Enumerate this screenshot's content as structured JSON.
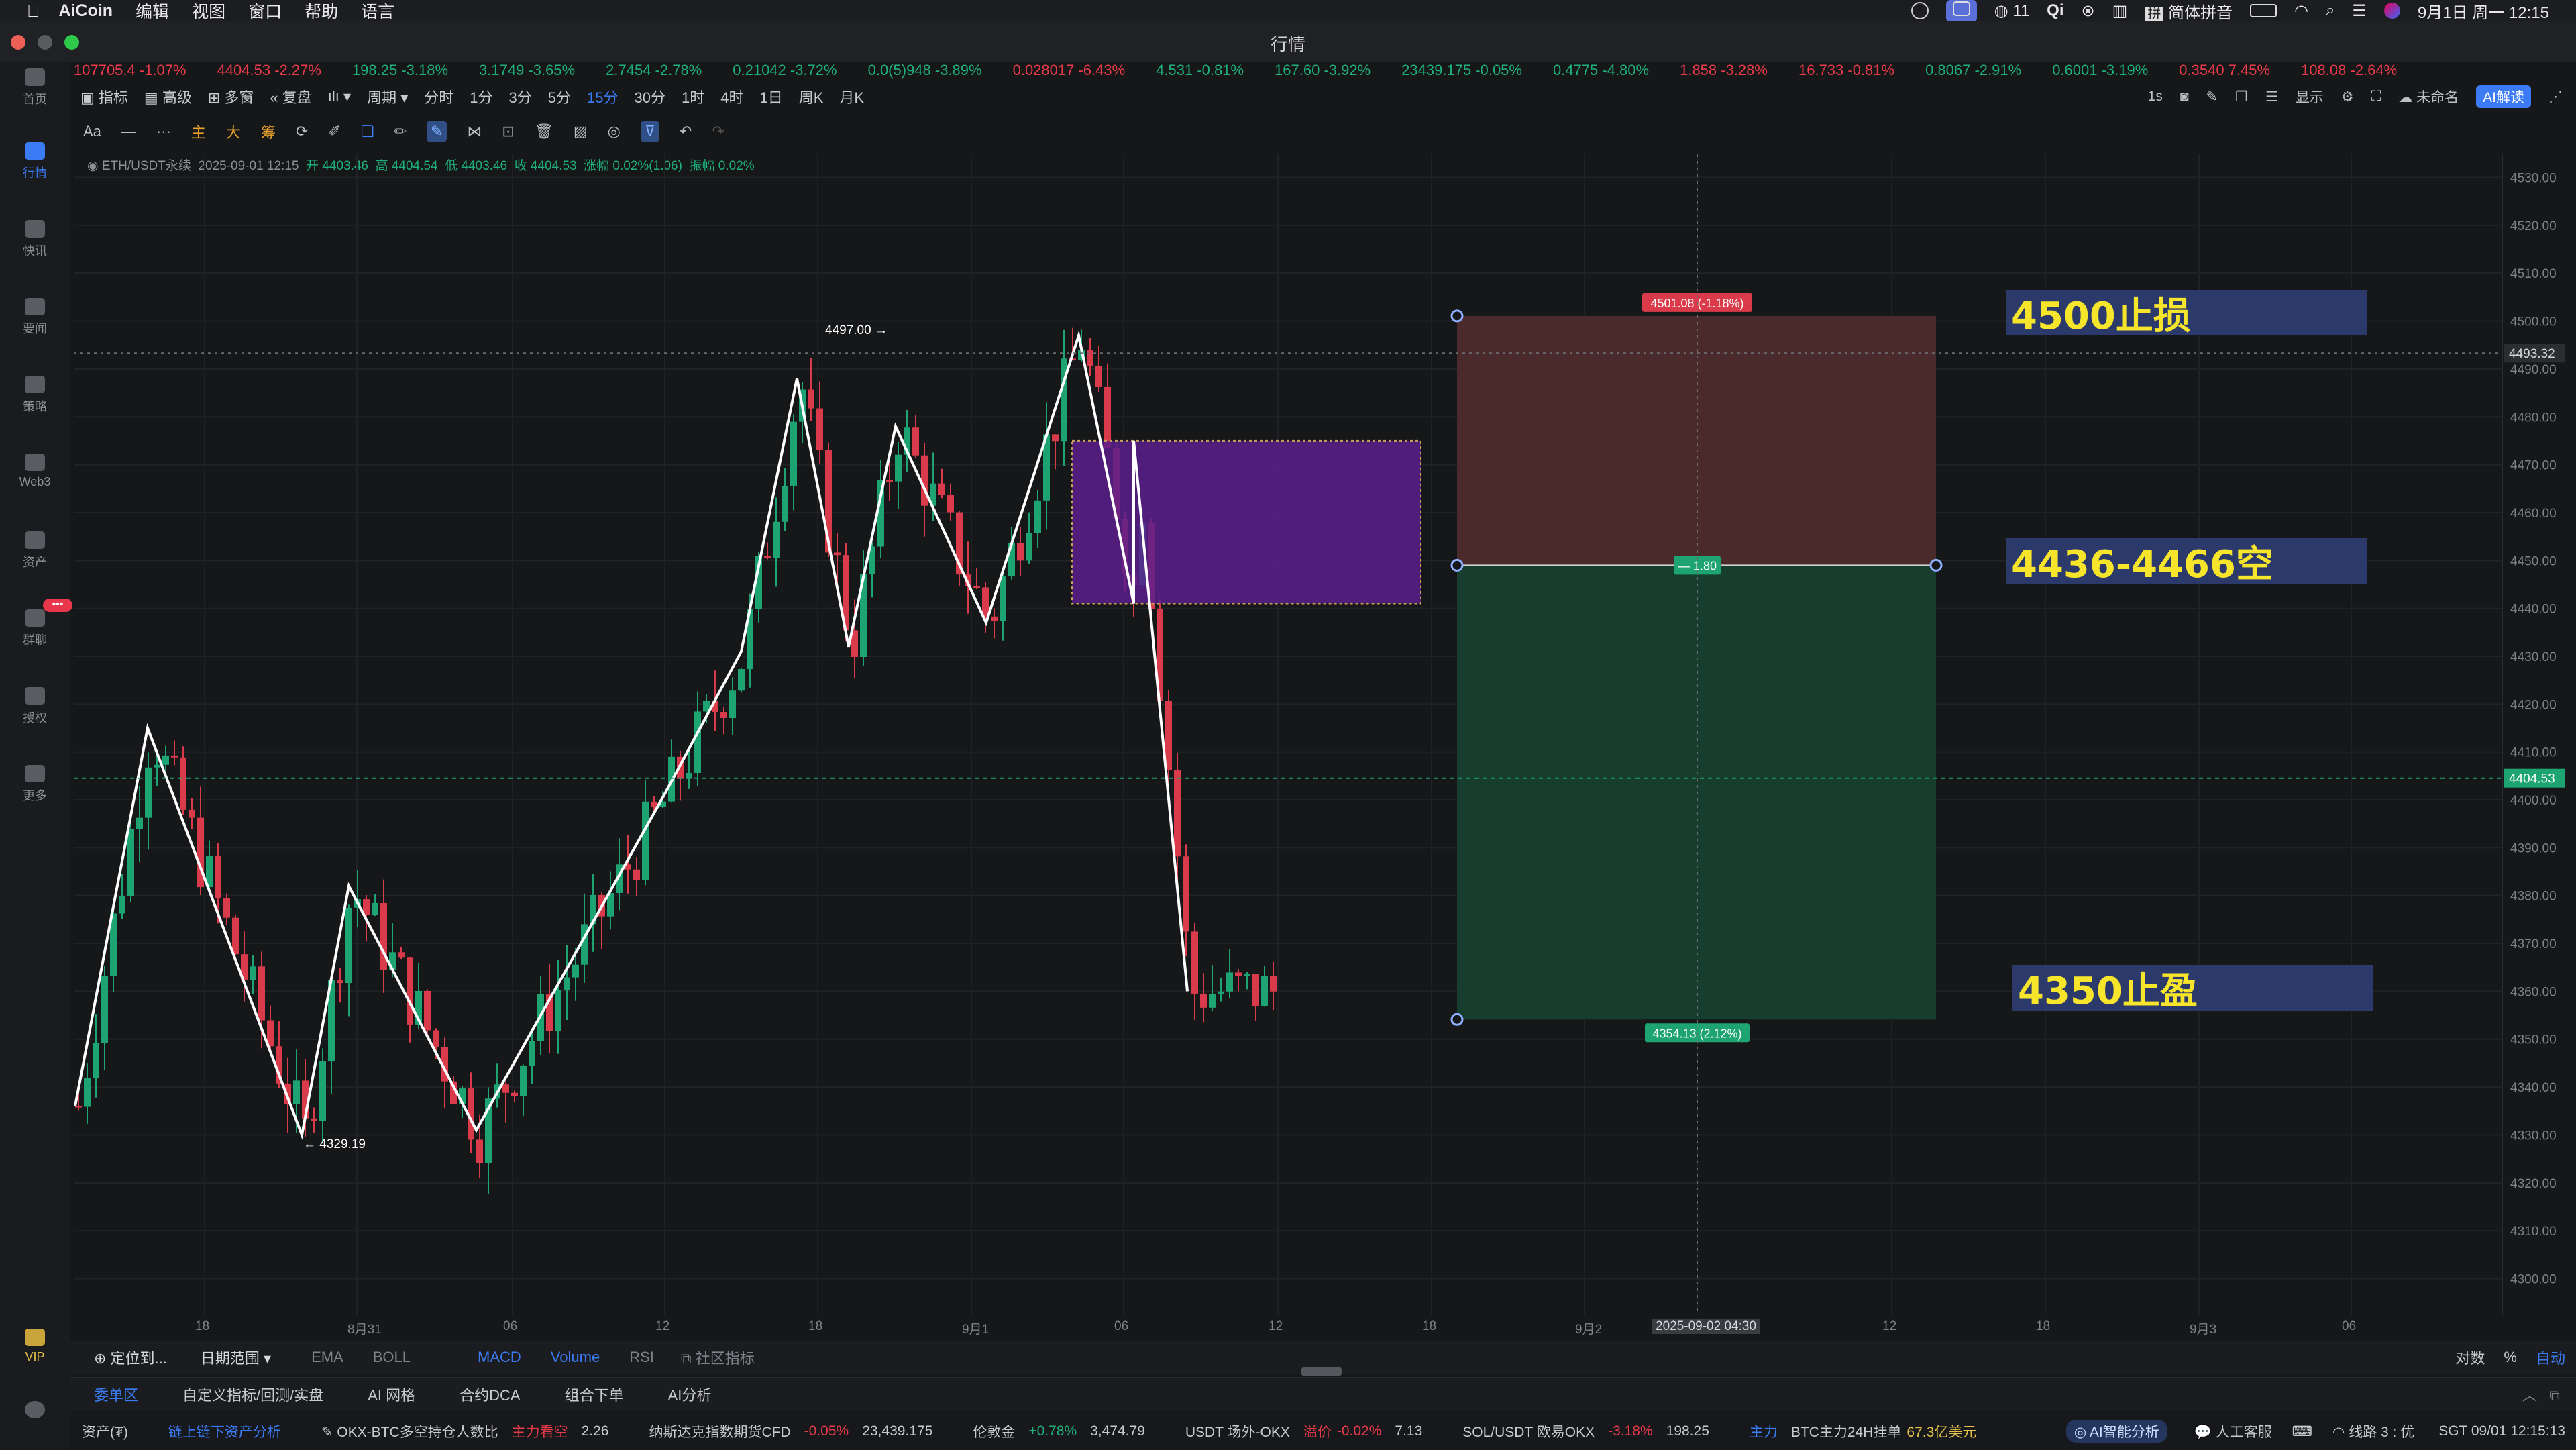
{
  "menubar": {
    "app": "AiCoin",
    "items": [
      "编辑",
      "视图",
      "窗口",
      "帮助",
      "语言"
    ],
    "wechat_count": "11",
    "ime": "简体拼音",
    "datetime": "9月1日 周一  12:15"
  },
  "window_title": "行情",
  "ticker": [
    {
      "text": "107705.4  -1.07%",
      "color": "red"
    },
    {
      "text": "4404.53  -2.27%",
      "color": "red"
    },
    {
      "text": "198.25  -3.18%",
      "color": "green"
    },
    {
      "text": "3.1749  -3.65%",
      "color": "green"
    },
    {
      "text": "2.7454  -2.78%",
      "color": "green"
    },
    {
      "text": "0.21042  -3.72%",
      "color": "green"
    },
    {
      "text": "0.0(5)948  -3.89%",
      "color": "green"
    },
    {
      "text": "0.028017  -6.43%",
      "color": "red"
    },
    {
      "text": "4.531  -0.81%",
      "color": "green"
    },
    {
      "text": "167.60  -3.92%",
      "color": "green"
    },
    {
      "text": "23439.175  -0.05%",
      "color": "green"
    },
    {
      "text": "0.4775  -4.80%",
      "color": "green"
    },
    {
      "text": "1.858  -3.28%",
      "color": "red"
    },
    {
      "text": "16.733  -0.81%",
      "color": "red"
    },
    {
      "text": "0.8067  -2.91%",
      "color": "green"
    },
    {
      "text": "0.6001  -3.19%",
      "color": "green"
    },
    {
      "text": "0.3540  7.45%",
      "color": "red"
    },
    {
      "text": "108.08  -2.64%",
      "color": "red"
    }
  ],
  "leftnav": [
    "首页",
    "行情",
    "快讯",
    "要闻",
    "策略",
    "Web3",
    "资产",
    "群聊",
    "授权",
    "更多",
    "VIP"
  ],
  "toolbar": {
    "indicator": "指标",
    "advanced": "高级",
    "multi": "多窗",
    "replay": "复盘",
    "period": "周期",
    "periods": [
      "分时",
      "1分",
      "3分",
      "5分",
      "15分",
      "30分",
      "1时",
      "4时",
      "1日",
      "周K",
      "月K"
    ],
    "active_period": "15分",
    "right_interval": "1s",
    "display": "显示",
    "unnamed": "未命名",
    "ai_read": "AI解读"
  },
  "tools2": [
    "Aa",
    "主",
    "大",
    "筹"
  ],
  "ohlc": {
    "symbol": "ETH/USDT永续",
    "time": "2025-09-01 12:15",
    "open": "开 4403.46",
    "high": "高 4404.54",
    "low": "低 4403.46",
    "close": "收 4404.53",
    "change": "涨幅 0.02%(1.06)",
    "amplitude": "振幅 0.02%"
  },
  "price_axis": {
    "ticks": [
      "4530.00",
      "4520.00",
      "4510.00",
      "4500.00",
      "4490.00",
      "4480.00",
      "4470.00",
      "4460.00",
      "4450.00",
      "4440.00",
      "4430.00",
      "4420.00",
      "4410.00",
      "4400.00",
      "4390.00",
      "4380.00",
      "4370.00",
      "4360.00",
      "4350.00",
      "4340.00",
      "4330.00",
      "4320.00",
      "4310.00",
      "4300.00"
    ],
    "crosshair": "4493.32",
    "last": "4404.53"
  },
  "time_axis": [
    "18",
    "8月31",
    "06",
    "12",
    "18",
    "9月1",
    "06",
    "12",
    "18",
    "9月2",
    "2025-09-02 04:30",
    "12",
    "18",
    "9月3",
    "06"
  ],
  "markers": {
    "high": "4497.00 →",
    "low": "← 4329.19"
  },
  "position": {
    "sl_tag": "4501.08 (-1.18%)",
    "ratio": "1.80",
    "tp_tag": "4354.13 (2.12%)"
  },
  "annotations": {
    "sl": "4500止损",
    "entry": "4436-4466空",
    "tp": "4350止盈"
  },
  "indicator_bar": {
    "locate": "定位到...",
    "range": "日期范围",
    "main": [
      "EMA",
      "BOLL"
    ],
    "sub": [
      "MACD",
      "Volume",
      "RSI"
    ],
    "community": "社区指标",
    "right": [
      "对数",
      "%",
      "自动"
    ]
  },
  "tabs": [
    "委单区",
    "自定义指标/回测/实盘",
    "AI 网格",
    "合约DCA",
    "组合下单",
    "AI分析"
  ],
  "statusbar": {
    "asset": "资产(₮)",
    "chain": "链上链下资产分析",
    "okx_label": "OKX-BTC多空持仓人数比",
    "okx_tag": "主力看空",
    "okx_val": "2.26",
    "ndx": "纳斯达克指数期货CFD",
    "ndx_chg": "-0.05%",
    "ndx_val": "23,439.175",
    "gold": "伦敦金",
    "gold_chg": "+0.78%",
    "gold_val": "3,474.79",
    "usdt": "USDT 场外-OKX",
    "usdt_tag": "溢价",
    "usdt_chg": "-0.02%",
    "usdt_val": "7.13",
    "sol": "SOL/USDT 欧易OKX",
    "sol_chg": "-3.18%",
    "sol_val": "198.25",
    "main": "主力",
    "btc": "BTC主力24H挂单",
    "btc_val": "67.3亿美元",
    "ai": "AI智能分析",
    "service": "人工客服",
    "line": "线路 3 : 优",
    "time": "SGT 09/01 12:15:13"
  },
  "chart_data": {
    "type": "candlestick",
    "symbol": "ETH/USDT perpetual 15m",
    "ylim": [
      4296,
      4534
    ],
    "last_price": 4404.53,
    "zigzag": [
      4336,
      4415,
      4330,
      4382,
      4331,
      4401,
      4431,
      4488,
      4432,
      4478,
      4437,
      4497,
      4441,
      4475,
      4360
    ],
    "marked_high": 4497.0,
    "marked_low": 4329.19,
    "supply_zone": [
      4441,
      4475
    ],
    "short_position": {
      "entry": 4449,
      "stop": 4501.08,
      "target": 4354.13,
      "rr": 1.8
    },
    "price_range": [
      4290,
      4535
    ]
  }
}
